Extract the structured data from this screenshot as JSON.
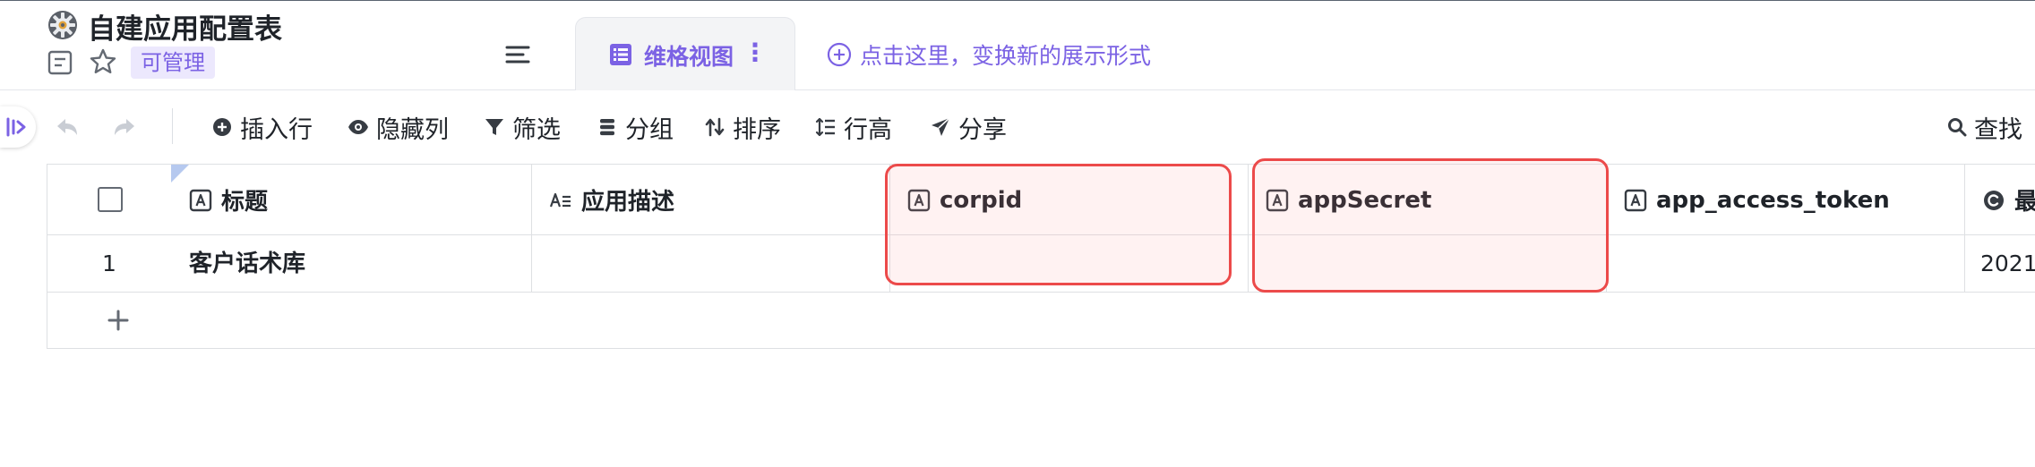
{
  "header": {
    "app_title": "自建应用配置表",
    "permission_badge": "可管理",
    "active_tab": {
      "label": "维格视图"
    },
    "add_view_label": "点击这里，变换新的展示形式"
  },
  "toolbar": {
    "insert_row": "插入行",
    "hide_columns": "隐藏列",
    "filter": "筛选",
    "group": "分组",
    "sort": "排序",
    "row_height": "行高",
    "share": "分享",
    "search": "查找"
  },
  "table": {
    "columns": [
      {
        "label": "标题",
        "icon": "text-field-icon"
      },
      {
        "label": "应用描述",
        "icon": "long-text-field-icon"
      },
      {
        "label": "corpid",
        "icon": "text-field-icon"
      },
      {
        "label": "appSecret",
        "icon": "text-field-icon"
      },
      {
        "label": "app_access_token",
        "icon": "text-field-icon"
      },
      {
        "label": "最",
        "icon": "clock-field-icon"
      }
    ],
    "rows": [
      {
        "index": "1",
        "title": "客户话术库",
        "description": "",
        "corpid": "",
        "appSecret": "",
        "app_access_token": "",
        "time": "2021/"
      }
    ]
  },
  "colors": {
    "accent": "#7b62e4",
    "highlight_border": "#ec4a4a",
    "grid_line": "#dee0e3"
  }
}
